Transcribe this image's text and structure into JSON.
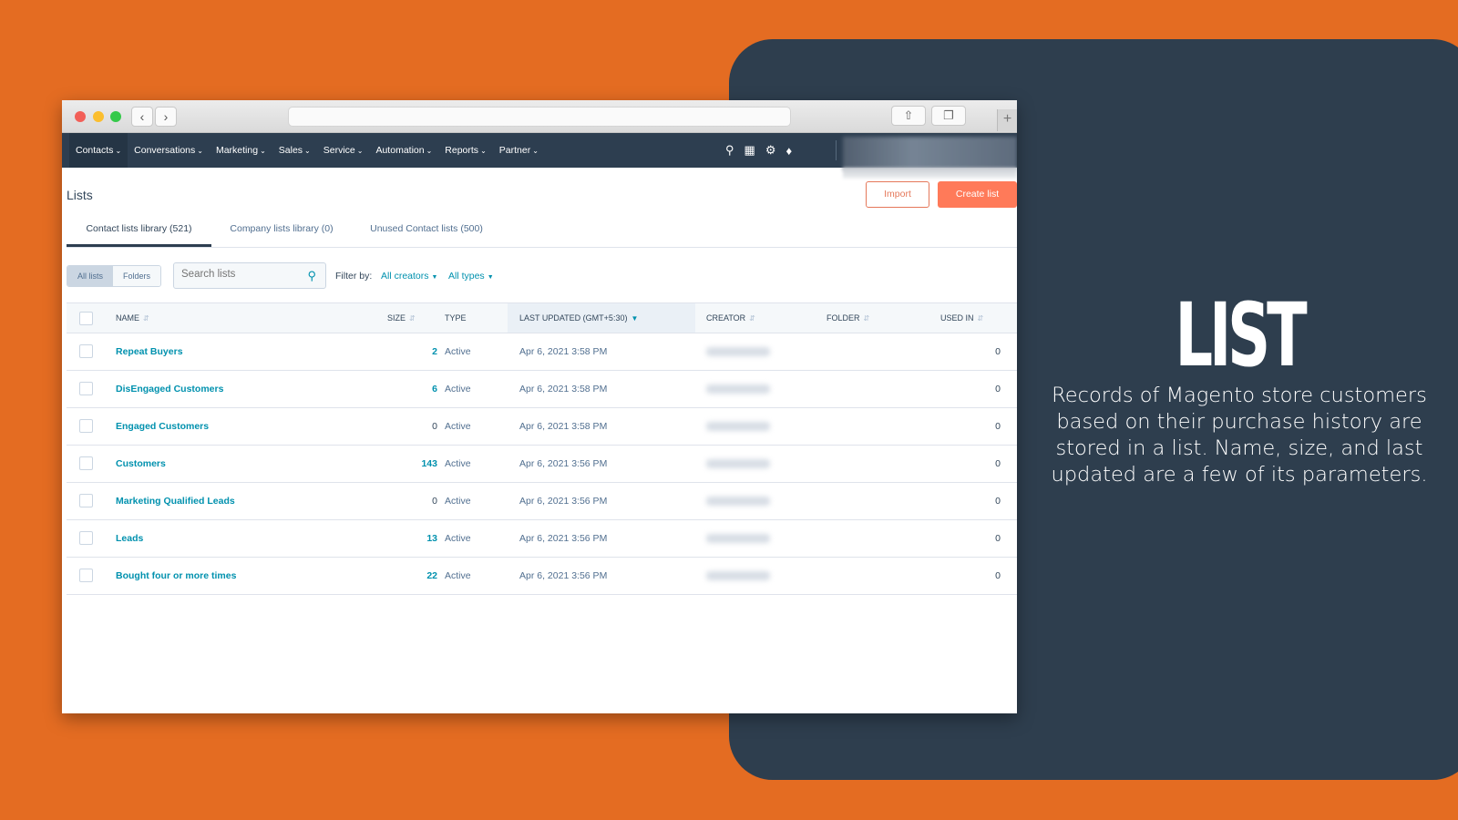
{
  "colors": {
    "background": "#E46C22",
    "panel": "#2E3E4E",
    "nav": "#2D3E50",
    "accent": "#FF7A59",
    "link": "#0091AE"
  },
  "promo": {
    "title": "LIST",
    "text": "Records of Magento store customers based on their purchase history are stored in a list. Name, size, and last updated are a few of its parameters."
  },
  "browser": {
    "back_icon": "chevron-left-icon",
    "forward_icon": "chevron-right-icon",
    "share_icon": "share-icon",
    "tabs_icon": "tabs-icon",
    "new_tab_icon": "plus-icon"
  },
  "topnav": {
    "items": [
      {
        "label": "Contacts"
      },
      {
        "label": "Conversations"
      },
      {
        "label": "Marketing"
      },
      {
        "label": "Sales"
      },
      {
        "label": "Service"
      },
      {
        "label": "Automation"
      },
      {
        "label": "Reports"
      },
      {
        "label": "Partner"
      }
    ],
    "icons": [
      "search-icon",
      "marketplace-icon",
      "gear-icon",
      "bell-icon"
    ]
  },
  "page": {
    "title": "Lists",
    "import_label": "Import",
    "create_label": "Create list",
    "tabs": [
      {
        "label": "Contact lists library (521)"
      },
      {
        "label": "Company lists library (0)"
      },
      {
        "label": "Unused Contact lists (500)"
      }
    ],
    "toggle": {
      "all_lists": "All lists",
      "folders": "Folders"
    },
    "search": {
      "placeholder": "Search lists"
    },
    "filter": {
      "label": "Filter by:",
      "creators": "All creators",
      "types": "All types"
    }
  },
  "table": {
    "columns": [
      "NAME",
      "SIZE",
      "TYPE",
      "LAST UPDATED (GMT+5:30)",
      "CREATOR",
      "FOLDER",
      "USED IN"
    ],
    "rows": [
      {
        "name": "Repeat Buyers",
        "size": "2",
        "type": "Active",
        "updated": "Apr 6, 2021 3:58 PM",
        "used": "0"
      },
      {
        "name": "DisEngaged Customers",
        "size": "6",
        "type": "Active",
        "updated": "Apr 6, 2021 3:58 PM",
        "used": "0"
      },
      {
        "name": "Engaged Customers",
        "size": "0",
        "type": "Active",
        "updated": "Apr 6, 2021 3:58 PM",
        "used": "0"
      },
      {
        "name": "Customers",
        "size": "143",
        "type": "Active",
        "updated": "Apr 6, 2021 3:56 PM",
        "used": "0"
      },
      {
        "name": "Marketing Qualified Leads",
        "size": "0",
        "type": "Active",
        "updated": "Apr 6, 2021 3:56 PM",
        "used": "0"
      },
      {
        "name": "Leads",
        "size": "13",
        "type": "Active",
        "updated": "Apr 6, 2021 3:56 PM",
        "used": "0"
      },
      {
        "name": "Bought four or more times",
        "size": "22",
        "type": "Active",
        "updated": "Apr 6, 2021 3:56 PM",
        "used": "0"
      }
    ]
  }
}
